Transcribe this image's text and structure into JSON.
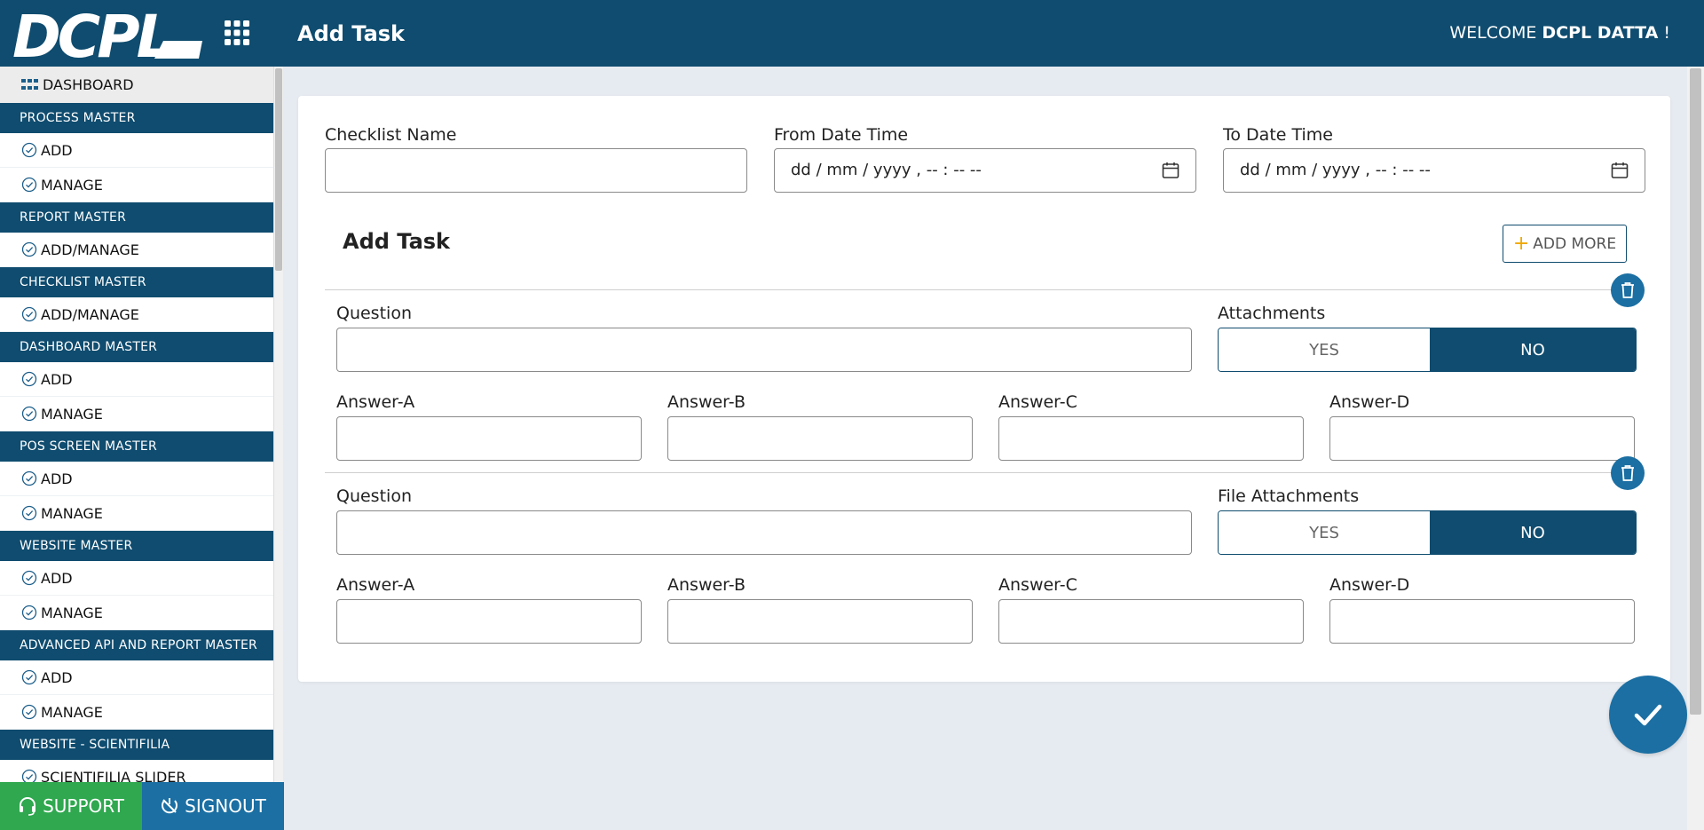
{
  "header": {
    "logo_text": "DCPL",
    "title": "Add Task",
    "welcome_prefix": "WELCOME ",
    "welcome_user": "DCPL DATTA",
    "welcome_suffix": " !"
  },
  "sidebar": {
    "dashboard": "DASHBOARD",
    "sections": [
      {
        "title": "PROCESS MASTER",
        "items": [
          "ADD",
          "MANAGE"
        ]
      },
      {
        "title": "REPORT MASTER",
        "items": [
          "ADD/MANAGE"
        ]
      },
      {
        "title": "CHECKLIST MASTER",
        "items": [
          "ADD/MANAGE"
        ]
      },
      {
        "title": "DASHBOARD MASTER",
        "items": [
          "ADD",
          "MANAGE"
        ]
      },
      {
        "title": "POS SCREEN MASTER",
        "items": [
          "ADD",
          "MANAGE"
        ]
      },
      {
        "title": "WEBSITE MASTER",
        "items": [
          "ADD",
          "MANAGE"
        ]
      },
      {
        "title": "ADVANCED API AND REPORT MASTER",
        "items": [
          "ADD",
          "MANAGE"
        ]
      },
      {
        "title": "WEBSITE - SCIENTIFILIA",
        "items": [
          "SCIENTIFILIA SLIDER"
        ]
      }
    ]
  },
  "footer": {
    "support": "SUPPORT",
    "signout": "SIGNOUT"
  },
  "form": {
    "checklist_name_label": "Checklist Name",
    "checklist_name_value": "",
    "from_label": "From Date Time",
    "from_value": "dd / mm / yyyy ,  -- : --   --",
    "to_label": "To Date Time",
    "to_value": "dd / mm / yyyy ,  -- : --   --",
    "section_title": "Add Task",
    "add_more": "ADD MORE"
  },
  "tasks": [
    {
      "question_label": "Question",
      "attach_label": "Attachments",
      "yes": "YES",
      "no": "NO",
      "answers": [
        "Answer-A",
        "Answer-B",
        "Answer-C",
        "Answer-D"
      ]
    },
    {
      "question_label": "Question",
      "attach_label": "File Attachments",
      "yes": "YES",
      "no": "NO",
      "answers": [
        "Answer-A",
        "Answer-B",
        "Answer-C",
        "Answer-D"
      ]
    }
  ],
  "colors": {
    "primary": "#0f4c6f",
    "accent": "#1b6fa3",
    "support": "#2fa84f",
    "plus": "#f0a800"
  }
}
